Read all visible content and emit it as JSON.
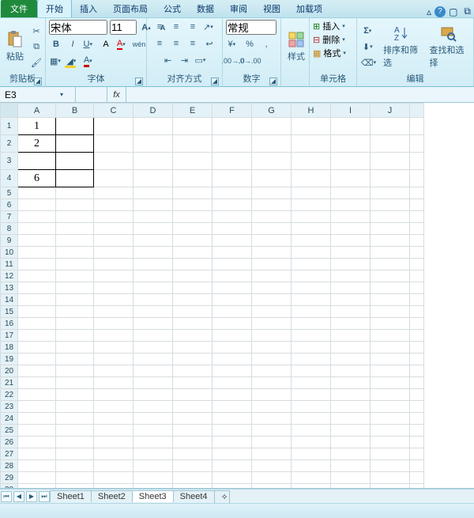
{
  "tabs": {
    "file": "文件",
    "home": "开始",
    "insert": "插入",
    "layout": "页面布局",
    "formulas": "公式",
    "data": "数据",
    "review": "审阅",
    "view": "视图",
    "addins": "加载项"
  },
  "ribbon": {
    "clipboard": {
      "paste": "粘贴",
      "label": "剪贴板"
    },
    "font": {
      "name": "宋体",
      "size": "11",
      "label": "字体"
    },
    "align": {
      "label": "对齐方式"
    },
    "number": {
      "format": "常规",
      "label": "数字"
    },
    "styles": {
      "btn": "样式",
      "label": ""
    },
    "cells": {
      "insert": "插入",
      "delete": "删除",
      "format": "格式",
      "label": "单元格"
    },
    "editing": {
      "sort": "排序和筛选",
      "find": "查找和选择",
      "label": "编辑"
    }
  },
  "namebox": "E3",
  "fx_label": "fx",
  "formula": "",
  "columns": [
    "A",
    "B",
    "C",
    "D",
    "E",
    "F",
    "G",
    "H",
    "I",
    "J"
  ],
  "rows": 31,
  "cells": {
    "A1": "1",
    "A2": "2",
    "A3": "",
    "A4": "6"
  },
  "sheets": [
    "Sheet1",
    "Sheet2",
    "Sheet3",
    "Sheet4"
  ],
  "active_sheet": 2
}
